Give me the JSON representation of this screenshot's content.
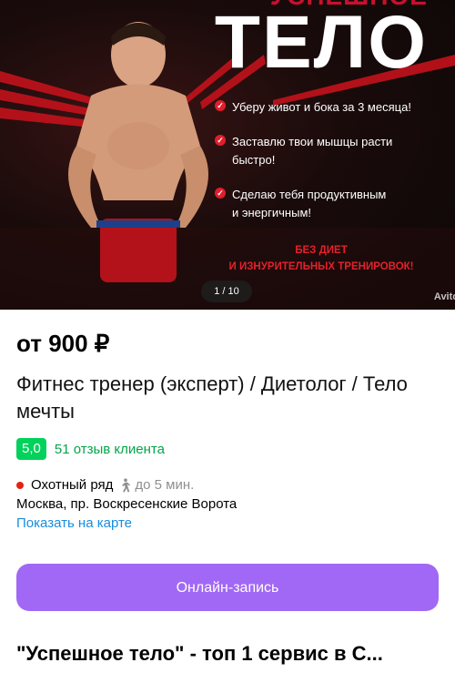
{
  "gallery": {
    "title_top": "УСПЕШНОЕ",
    "title_main": "ТЕЛО",
    "bullets": [
      {
        "line1": "Уберу живот и бока за 3 месяца!",
        "line2": ""
      },
      {
        "line1": "Заставлю твои мышцы расти",
        "line2": "быстро!"
      },
      {
        "line1": "Сделаю тебя продуктивным",
        "line2": "и энергичным!"
      }
    ],
    "promo_line1": "БЕЗ ДИЕТ",
    "promo_line2": "И ИЗНУРИТЕЛЬНЫХ ТРЕНИРОВОК!",
    "counter": "1 / 10",
    "watermark": "Avito"
  },
  "listing": {
    "price": "от 900 ₽",
    "title": "Фитнес тренер (эксперт) / Диетолог / Тело мечты",
    "rating": "5,0",
    "reviews": "51 отзыв клиента",
    "metro": "Охотный ряд",
    "walk_time": "до 5 мин.",
    "address": "Москва, пр. Воскресенские Ворота",
    "map_link": "Показать на карте",
    "book_button": "Онлайн-запись",
    "section_title": "\"Успешное тело\" - топ 1 сервис в С..."
  },
  "colors": {
    "rating_bg": "#02d15c",
    "reviews_text": "#02a649",
    "metro_dot": "#e42313",
    "link": "#1a8cdd",
    "button": "#a168f5",
    "accent_red": "#e01e2b"
  }
}
